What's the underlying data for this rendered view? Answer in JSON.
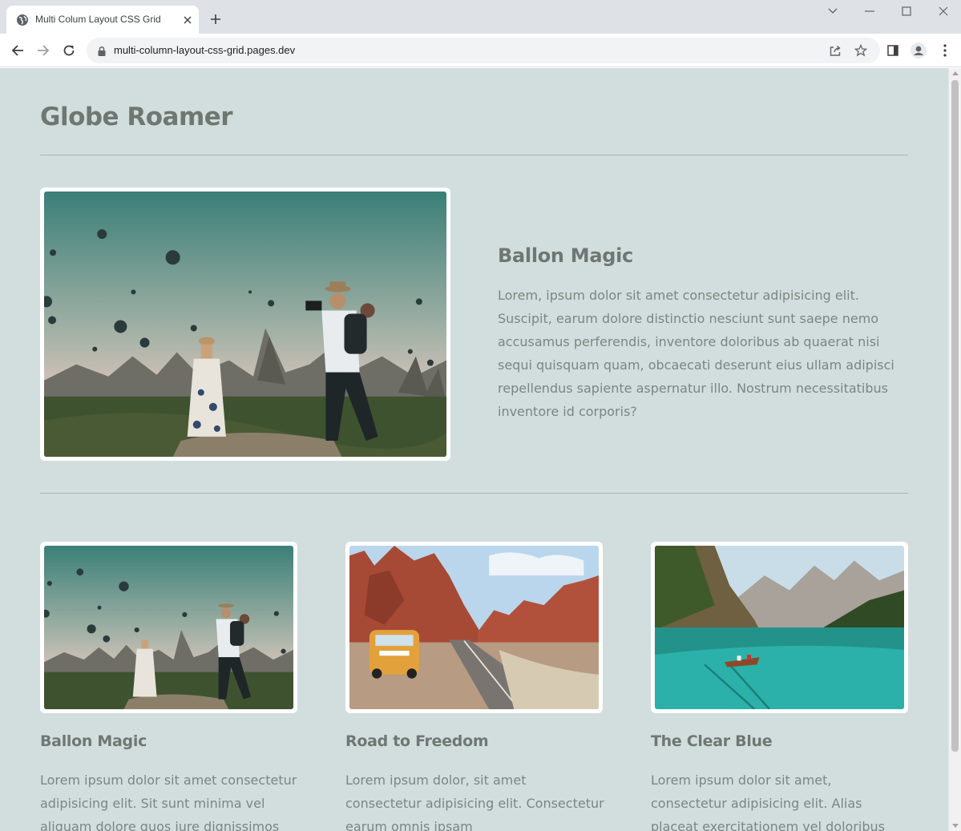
{
  "browser": {
    "tab_title": "Multi Colum Layout CSS Grid",
    "url": "multi-column-layout-css-grid.pages.dev"
  },
  "icons": {
    "favicon": "globe-icon",
    "tab_close": "close-icon",
    "new_tab": "plus-icon",
    "tab_search": "chevron-down-icon",
    "minimize": "minimize-icon",
    "maximize": "maximize-icon",
    "close_window": "close-icon",
    "back": "arrow-left-icon",
    "forward": "arrow-right-icon",
    "reload": "reload-icon",
    "lock": "lock-icon",
    "share": "share-icon",
    "bookmark": "star-icon",
    "side_panel": "side-panel-icon",
    "profile": "profile-icon",
    "menu": "kebab-menu-icon"
  },
  "page": {
    "site_title": "Globe Roamer",
    "colors": {
      "background": "#d2dedd",
      "heading": "#6f7773",
      "body_text": "#7c8582",
      "frame": "#ffffff"
    },
    "feature": {
      "title": "Ballon Magic",
      "body": "Lorem, ipsum dolor sit amet consectetur adipisicing elit. Suscipit, earum dolore distinctio nesciunt sunt saepe nemo accusamus perferendis, inventore doloribus ab quaerat nisi sequi quisquam quam, obcaecati deserunt eius ullam adipisci repellendus sapiente aspernatur illo. Nostrum necessitatibus inventore id corporis?"
    },
    "cards": [
      {
        "title": "Ballon Magic",
        "body": "Lorem ipsum dolor sit amet consectetur adipisicing elit. Sit sunt minima vel aliquam dolore quos iure dignissimos"
      },
      {
        "title": "Road to Freedom",
        "body": "Lorem ipsum dolor, sit amet consectetur adipisicing elit. Consectetur earum omnis ipsam"
      },
      {
        "title": "The Clear Blue",
        "body": "Lorem ipsum dolor sit amet, consectetur adipisicing elit. Alias placeat exercitationem vel doloribus"
      }
    ]
  }
}
